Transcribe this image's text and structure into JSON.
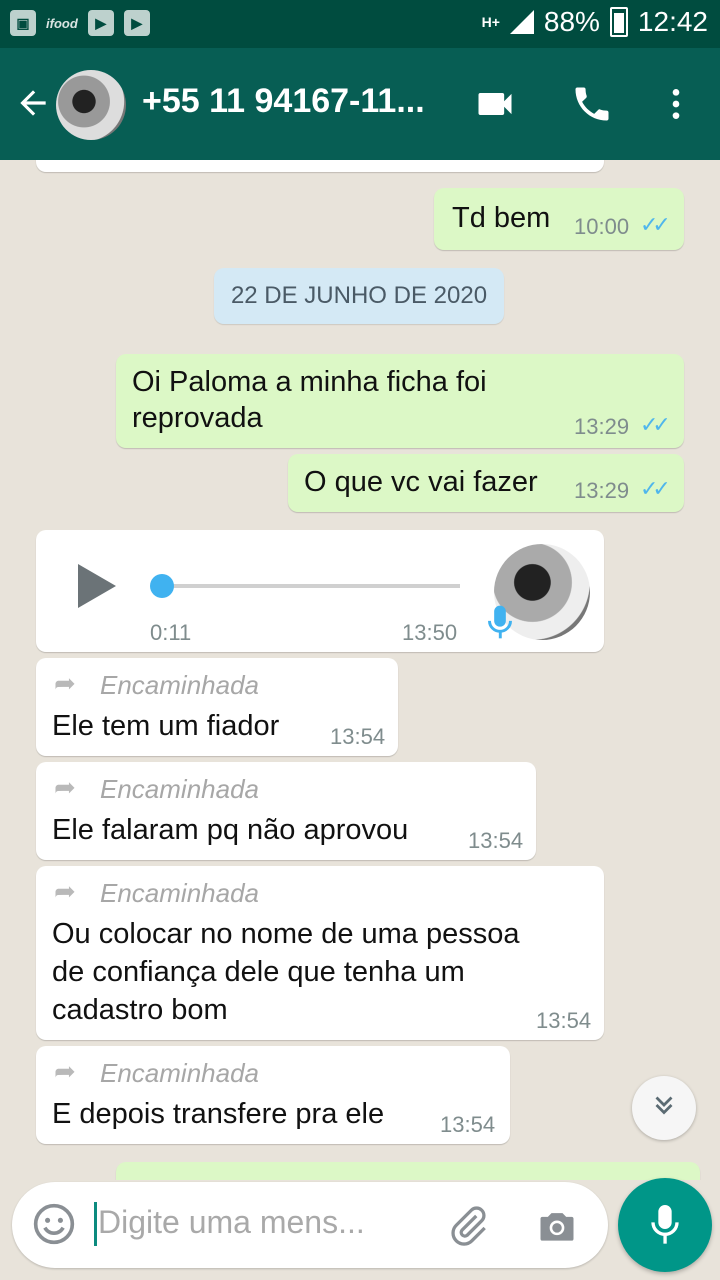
{
  "status_bar": {
    "app_icons": [
      "image-icon",
      "ifood",
      "youtube-icon",
      "youtube-icon"
    ],
    "ifood_text": "ifood",
    "network": "H+",
    "battery": "88%",
    "time": "12:42"
  },
  "header": {
    "contact_name": "+55 11 94167-11...",
    "icons": [
      "back-arrow-icon",
      "video-call-icon",
      "phone-icon",
      "more-vert-icon"
    ]
  },
  "date_chip": "22 DE JUNHO DE 2020",
  "messages": [
    {
      "type": "out",
      "text": "Td bem",
      "time": "10:00"
    },
    {
      "type": "out",
      "text": "Oi Paloma a minha  ficha foi reprovada",
      "line1": "Oi Paloma a minha  ficha foi",
      "line2": "reprovada",
      "time": "13:29"
    },
    {
      "type": "out",
      "text": "O que vc vai fazer",
      "time": "13:29"
    },
    {
      "type": "audio",
      "duration": "0:11",
      "time": "13:50",
      "progress": 0
    },
    {
      "type": "in",
      "forwarded_label": "Encaminhada",
      "text": "Ele tem um fiador",
      "time": "13:54"
    },
    {
      "type": "in",
      "forwarded_label": "Encaminhada",
      "text": "Ele falaram pq não aprovou",
      "time": "13:54"
    },
    {
      "type": "in",
      "forwarded_label": "Encaminhada",
      "line1": "Ou colocar no nome de uma pessoa",
      "line2": "de confiança dele que tenha um",
      "line3": "cadastro bom",
      "time": "13:54"
    },
    {
      "type": "in",
      "forwarded_label": "Encaminhada",
      "text": "E depois transfere pra ele",
      "time": "13:54"
    }
  ],
  "input": {
    "placeholder": "Digite uma mens..."
  },
  "colors": {
    "status_bar": "#004c3f",
    "toolbar": "#075e54",
    "outgoing_bubble": "#dcf8c6",
    "incoming_bubble": "#ffffff",
    "read_ticks": "#4fb6ec",
    "fab": "#009688"
  }
}
